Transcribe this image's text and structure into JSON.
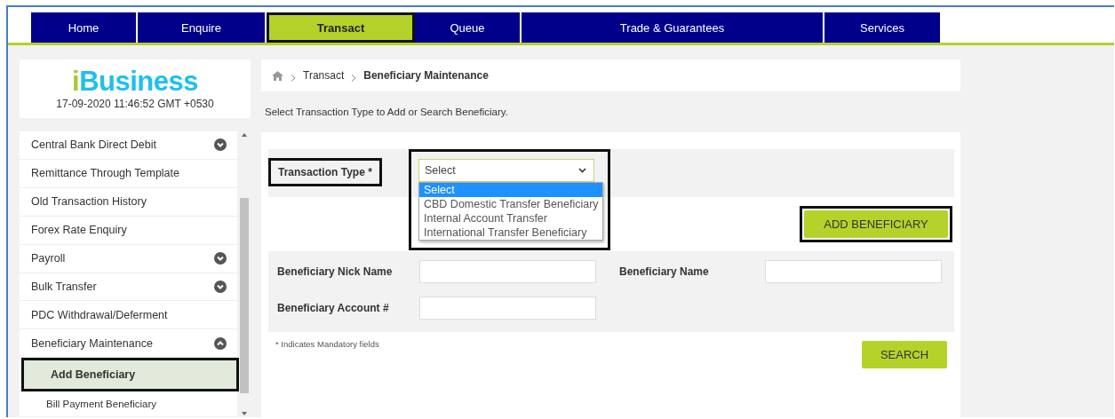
{
  "nav_tabs": [
    {
      "label": "Home",
      "selected": false,
      "highlighted": false
    },
    {
      "label": "Enquire",
      "selected": false,
      "highlighted": false
    },
    {
      "label": "Transact",
      "selected": true,
      "highlighted": true
    },
    {
      "label": "Queue",
      "selected": false,
      "highlighted": false
    },
    {
      "label": "Trade & Guarantees",
      "selected": false,
      "highlighted": false
    },
    {
      "label": "Services",
      "selected": false,
      "highlighted": false
    }
  ],
  "logo": {
    "accent": "i",
    "text": "Business"
  },
  "timestamp": "17-09-2020 11:46:52 GMT +0530",
  "sidebar": {
    "items": [
      {
        "label": "Central Bank Direct Debit",
        "kind": "group",
        "expanded": false
      },
      {
        "label": "Remittance Through Template",
        "kind": "link"
      },
      {
        "label": "Old Transaction History",
        "kind": "link"
      },
      {
        "label": "Forex Rate Enquiry",
        "kind": "link"
      },
      {
        "label": "Payroll",
        "kind": "group",
        "expanded": false
      },
      {
        "label": "Bulk Transfer",
        "kind": "group",
        "expanded": false
      },
      {
        "label": "PDC Withdrawal/Deferment",
        "kind": "link"
      },
      {
        "label": "Beneficiary Maintenance",
        "kind": "group",
        "expanded": true,
        "children": [
          {
            "label": "Add Beneficiary",
            "selected": true,
            "highlighted": true
          },
          {
            "label": "Bill Payment Beneficiary",
            "selected": false,
            "highlighted": false
          }
        ]
      }
    ]
  },
  "breadcrumb": [
    "Transact",
    "Beneficiary Maintenance"
  ],
  "instruction": "Select Transaction Type to Add or Search Beneficiary.",
  "form": {
    "transaction_type": {
      "label": "Transaction Type *",
      "label_highlighted": true,
      "value": "Select",
      "open": true,
      "highlighted": true,
      "options": [
        {
          "label": "Select",
          "selected": true
        },
        {
          "label": "CBD Domestic Transfer Beneficiary",
          "selected": false
        },
        {
          "label": "Internal Account Transfer",
          "selected": false
        },
        {
          "label": "International Transfer Beneficiary",
          "selected": false
        }
      ]
    },
    "add_button": {
      "label": "ADD BENEFICIARY",
      "highlighted": true
    },
    "search_fields": [
      {
        "label": "Beneficiary Nick Name"
      },
      {
        "label": "Beneficiary Name"
      },
      {
        "label": "Beneficiary Account #"
      }
    ],
    "note": "* Indicates Mandatory fields",
    "search_button": "SEARCH"
  }
}
